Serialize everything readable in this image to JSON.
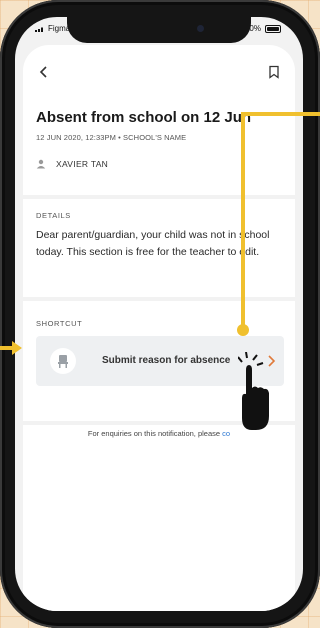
{
  "status_bar": {
    "carrier": "Figma",
    "battery": "100%"
  },
  "header": {
    "back_icon": "chevron-left-icon",
    "bookmark_icon": "bookmark-icon"
  },
  "notification": {
    "title": "Absent from school on 12 Jun",
    "meta": "12 JUN 2020, 12:33PM  •  SCHOOL'S NAME",
    "author": "XAVIER TAN"
  },
  "details": {
    "label": "DETAILS",
    "body": "Dear parent/guardian, your child was not in school today. This section is free for the teacher to edit."
  },
  "shortcut": {
    "label": "SHORTCUT",
    "button_label": "Submit reason for absence",
    "button_icon": "chair-icon",
    "chevron_color": "#e07a3b"
  },
  "footer": {
    "text": "For enquiries on this notification, please ",
    "link": "co"
  },
  "colors": {
    "annotation": "#f0c02e",
    "background": "#f6e3c7",
    "link": "#2a76d2"
  }
}
